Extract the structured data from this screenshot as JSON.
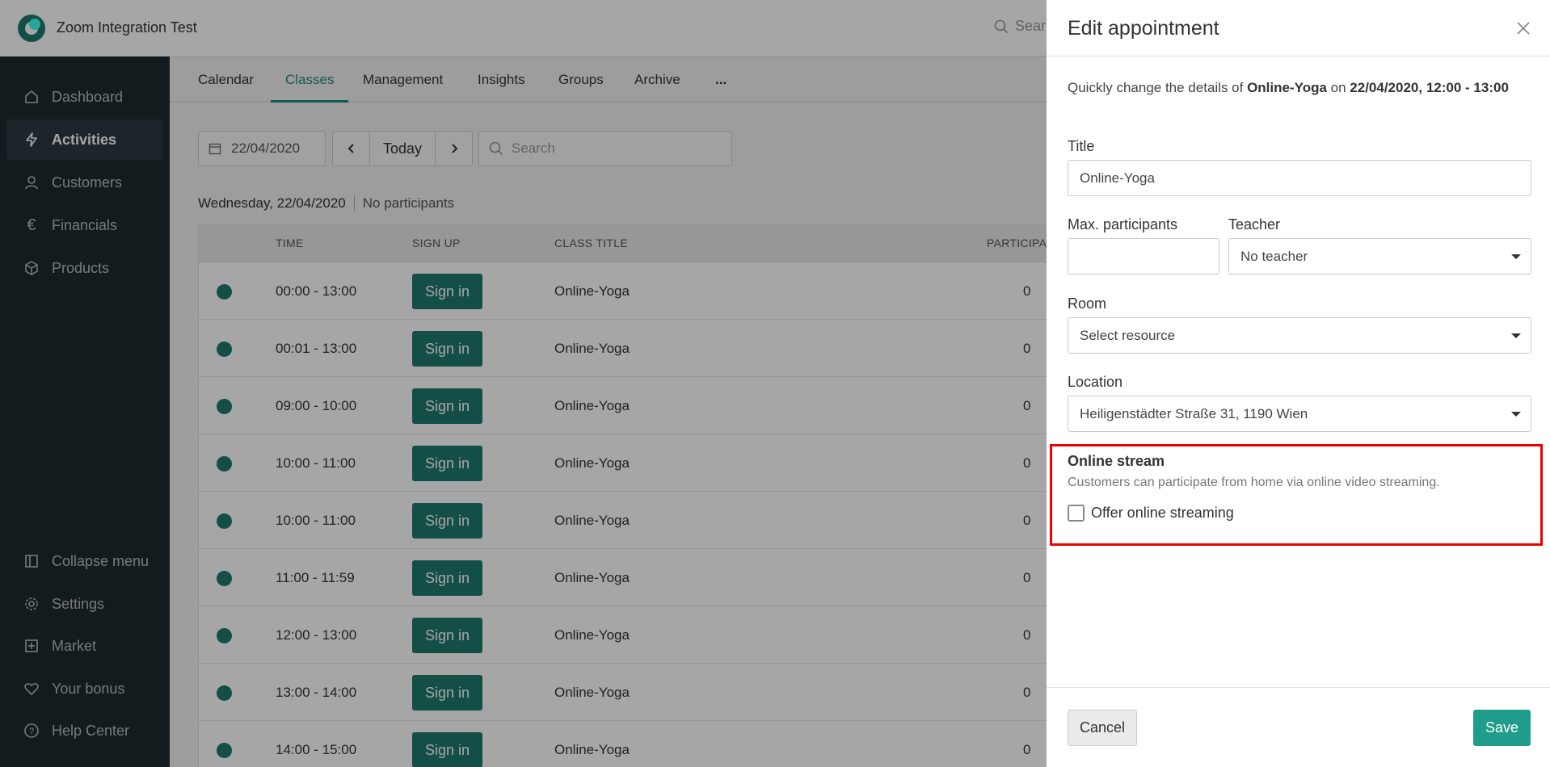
{
  "app": {
    "title": "Zoom Integration Test",
    "search_placeholder": "Sear"
  },
  "sidebar": {
    "items": [
      {
        "label": "Dashboard",
        "icon": "home-icon"
      },
      {
        "label": "Activities",
        "icon": "bolt-icon",
        "active": true
      },
      {
        "label": "Customers",
        "icon": "user-icon"
      },
      {
        "label": "Financials",
        "icon": "euro-icon"
      },
      {
        "label": "Products",
        "icon": "box-icon"
      }
    ],
    "bottom_items": [
      {
        "label": "Collapse menu",
        "icon": "collapse-icon"
      },
      {
        "label": "Settings",
        "icon": "gear-icon"
      },
      {
        "label": "Market",
        "icon": "plus-square-icon"
      },
      {
        "label": "Your bonus",
        "icon": "heart-icon"
      },
      {
        "label": "Help Center",
        "icon": "help-icon"
      }
    ]
  },
  "tabs": [
    "Calendar",
    "Classes",
    "Management",
    "Insights",
    "Groups",
    "Archive",
    "..."
  ],
  "active_tab": "Classes",
  "toolbar": {
    "date": "22/04/2020",
    "today": "Today",
    "search_placeholder": "Search"
  },
  "day_header": {
    "day": "Wednesday, 22/04/2020",
    "participants": "No participants"
  },
  "table": {
    "columns": [
      "TIME",
      "SIGN UP",
      "CLASS TITLE",
      "PARTICIPANTS"
    ],
    "rows": [
      {
        "time": "00:00 - 13:00",
        "signup": "Sign in",
        "title": "Online-Yoga",
        "participants": "0"
      },
      {
        "time": "00:01 - 13:00",
        "signup": "Sign in",
        "title": "Online-Yoga",
        "participants": "0"
      },
      {
        "time": "09:00 - 10:00",
        "signup": "Sign in",
        "title": "Online-Yoga",
        "participants": "0"
      },
      {
        "time": "10:00 - 11:00",
        "signup": "Sign in",
        "title": "Online-Yoga",
        "participants": "0"
      },
      {
        "time": "10:00 - 11:00",
        "signup": "Sign in",
        "title": "Online-Yoga",
        "participants": "0"
      },
      {
        "time": "11:00 - 11:59",
        "signup": "Sign in",
        "title": "Online-Yoga",
        "participants": "0"
      },
      {
        "time": "12:00 - 13:00",
        "signup": "Sign in",
        "title": "Online-Yoga",
        "participants": "0"
      },
      {
        "time": "13:00 - 14:00",
        "signup": "Sign in",
        "title": "Online-Yoga",
        "participants": "0"
      },
      {
        "time": "14:00 - 15:00",
        "signup": "Sign in",
        "title": "Online-Yoga",
        "participants": "0"
      }
    ]
  },
  "drawer": {
    "title": "Edit appointment",
    "intro_prefix": "Quickly change the details of ",
    "intro_class": "Online-Yoga",
    "intro_mid": " on ",
    "intro_when": "22/04/2020, 12:00 - 13:00",
    "title_label": "Title",
    "title_value": "Online-Yoga",
    "max_label": "Max. participants",
    "max_value": "",
    "teacher_label": "Teacher",
    "teacher_value": "No teacher",
    "room_label": "Room",
    "room_value": "Select resource",
    "location_label": "Location",
    "location_value": "Heiligenstädter Straße 31, 1190 Wien",
    "online_title": "Online stream",
    "online_desc": "Customers can participate from home via online video streaming.",
    "online_checkbox": "Offer online streaming",
    "online_checked": false,
    "cancel": "Cancel",
    "save": "Save"
  },
  "colors": {
    "accent": "#1f7a6d",
    "save": "#1f9c8a",
    "sidebar": "#1f2a30",
    "highlight": "#e00000"
  }
}
